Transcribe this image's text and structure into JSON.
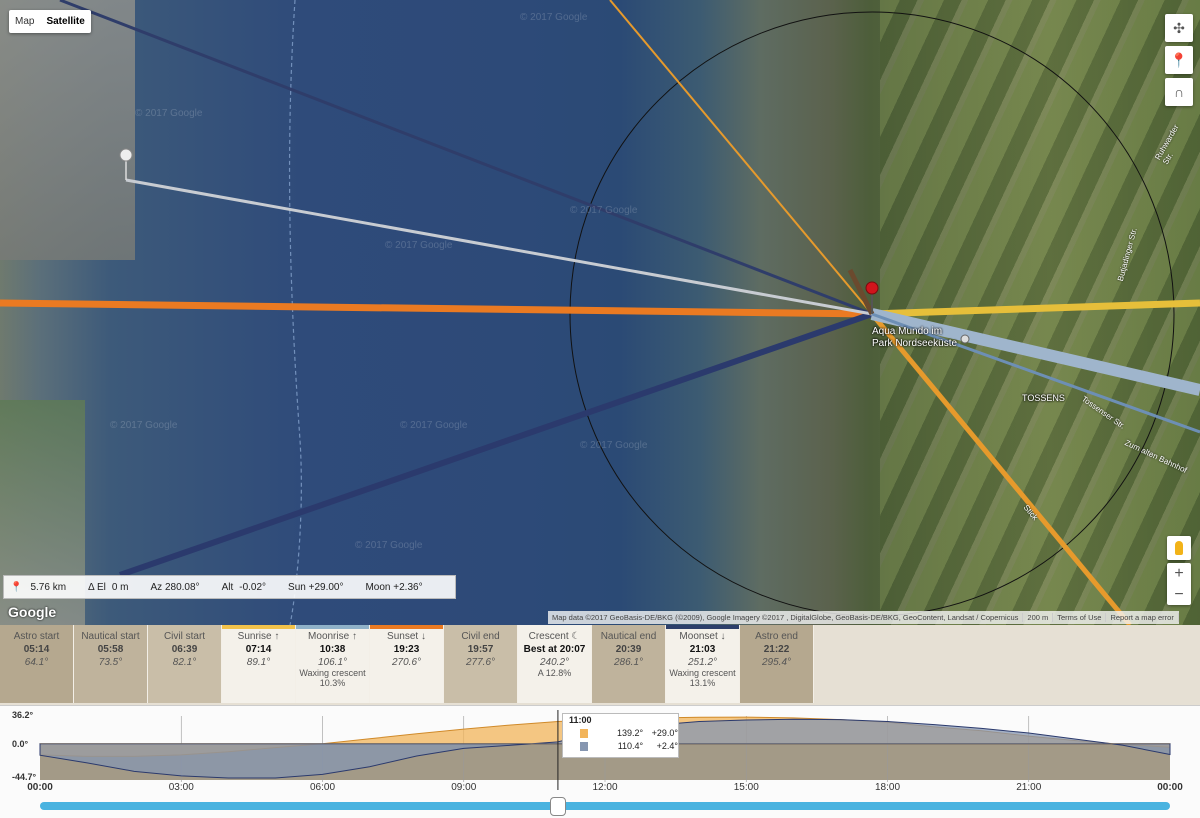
{
  "map": {
    "maptype": [
      "Map",
      "Satellite"
    ],
    "active_type": "Satellite",
    "watermark": "© 2017 Google",
    "place_labels": [
      "Aqua Mundo im",
      "Park Nordseeküste",
      "TOSSENS"
    ],
    "road_labels": [
      "Ruhwarder Str.",
      "Butjadinger Str.",
      "Tossenser Str.",
      "Zum alten Bahnhof",
      "Stick"
    ],
    "google_logo": "Google",
    "attribution": [
      "Map data ©2017 GeoBasis-DE/BKG (©2009), Google Imagery ©2017 , DigitalGlobe, GeoBasis-DE/BKG, GeoContent, Landsat / Copernicus",
      "200 m",
      "Terms of Use",
      "Report a map error"
    ],
    "zoom_in": "+",
    "zoom_out": "−"
  },
  "infobar": {
    "distance": "5.76 km",
    "delta_el_label": "Δ El",
    "delta_el": "0 m",
    "az": "Az 280.08°",
    "alt_label": "Alt",
    "alt": "-0.02°",
    "sun": "Sun +29.00°",
    "moon": "Moon +2.36°"
  },
  "events": [
    {
      "name": "Astro start",
      "time": "05:14",
      "az": "64.1°",
      "style": "dark4",
      "bar": ""
    },
    {
      "name": "Nautical start",
      "time": "05:58",
      "az": "73.5°",
      "style": "dark3",
      "bar": ""
    },
    {
      "name": "Civil start",
      "time": "06:39",
      "az": "82.1°",
      "style": "dark2",
      "bar": ""
    },
    {
      "name": "Sunrise ↑",
      "time": "07:14",
      "az": "89.1°",
      "style": "light",
      "bar": "#f2c24a"
    },
    {
      "name": "Moonrise ↑",
      "time": "10:38",
      "az": "106.1°",
      "sub": "Waxing crescent",
      "sub2": "10.3%",
      "style": "light",
      "bar": "#8fb1c8"
    },
    {
      "name": "Sunset ↓",
      "time": "19:23",
      "az": "270.6°",
      "style": "light",
      "bar": "#ea7a22"
    },
    {
      "name": "Civil end",
      "time": "19:57",
      "az": "277.6°",
      "style": "dark2",
      "bar": ""
    },
    {
      "name": "Crescent ☾",
      "time": "Best at 20:07",
      "az": "240.2°",
      "sub": "A 12.8%",
      "style": "light",
      "bar": ""
    },
    {
      "name": "Nautical end",
      "time": "20:39",
      "az": "286.1°",
      "style": "dark3",
      "bar": ""
    },
    {
      "name": "Moonset ↓",
      "time": "21:03",
      "az": "251.2°",
      "sub": "Waxing crescent",
      "sub2": "13.1%",
      "style": "light",
      "bar": "#2c3f6b"
    },
    {
      "name": "Astro end",
      "time": "21:22",
      "az": "295.4°",
      "style": "dark4",
      "bar": ""
    }
  ],
  "timeline": {
    "y_labels": [
      "36.2°",
      "0.0°",
      "-44.7°"
    ],
    "x_labels": [
      "00:00",
      "03:00",
      "06:00",
      "09:00",
      "12:00",
      "15:00",
      "18:00",
      "21:00",
      "00:00"
    ],
    "tooltip": {
      "time": "11:00",
      "sun_az": "139.2°",
      "sun_alt": "+29.0°",
      "moon_az": "110.4°",
      "moon_alt": "+2.4°"
    }
  },
  "chart_data": {
    "type": "area",
    "ylim": [
      -44.7,
      36.2
    ],
    "x_hours": [
      0,
      1,
      2,
      3,
      4,
      5,
      6,
      7,
      8,
      9,
      10,
      11,
      12,
      13,
      14,
      15,
      16,
      17,
      18,
      19,
      20,
      21,
      22,
      23,
      24
    ],
    "series": [
      {
        "values": [
          -14.5,
          -16.5,
          -16.5,
          -14.5,
          -10.5,
          -5,
          0,
          6.5,
          13,
          19,
          24.5,
          29,
          31.6,
          33.6,
          34.6,
          34.8,
          33.8,
          31.5,
          28,
          22,
          17,
          10,
          4,
          -1,
          -4.5
        ],
        "color": "#f2b45a"
      },
      {
        "values": [
          -15,
          -25,
          -36,
          -42,
          -44.7,
          -44.7,
          -40,
          -30,
          -16,
          -6,
          -2,
          2.4,
          18,
          24,
          29,
          31,
          32,
          31.5,
          29,
          25,
          20,
          14,
          6,
          -2,
          -14
        ],
        "color": "#8696b0"
      }
    ]
  },
  "colors": {
    "sun_orange": "#ea7a22",
    "sunrise_yellow": "#e6bf3a",
    "moon_dark": "#2b3a6d",
    "moon_light": "#9fb5cc",
    "slider": "#49b3e0"
  }
}
